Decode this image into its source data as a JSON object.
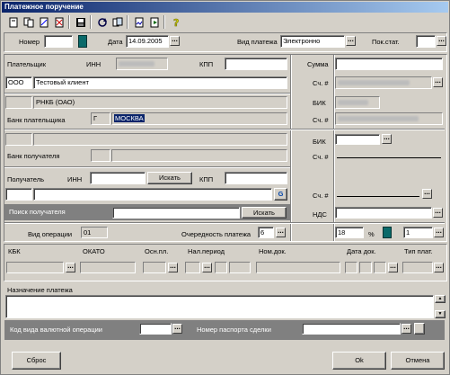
{
  "window": {
    "title": "Платежное поручение"
  },
  "toolbar": {
    "icons": [
      "new-document-icon",
      "copy-document-icon",
      "edit-document-icon",
      "delete-document-icon",
      "save-icon",
      "refresh-icon",
      "copy-icon",
      "sign-icon",
      "export-icon",
      "help-icon"
    ]
  },
  "doc": {
    "number_label": "Номер",
    "number_value": "",
    "date_label": "Дата",
    "date_value": "14.09.2005",
    "payment_type_label": "Вид платежа",
    "payment_type_value": "Электронно",
    "status_label": "Пок.стат.",
    "status_value": ""
  },
  "payer": {
    "label": "Плательщик",
    "inn_label": "ИНН",
    "kpp_label": "КПП",
    "name_prefix": "ООО",
    "name": "Тестовый клиент",
    "sum_label": "Сумма",
    "account_label": "Сч. #"
  },
  "payer_bank": {
    "name": "РНКБ (ОАО)",
    "label": "Банк плательщика",
    "city_prefix": "Г",
    "city": "МОСКВА",
    "bik_label": "БИК",
    "account_label": "Сч. #"
  },
  "payee_bank": {
    "label": "Банк получателя",
    "bik_label": "БИК",
    "account_label": "Сч. #"
  },
  "payee": {
    "label": "Получатель",
    "inn_label": "ИНН",
    "search_button": "Искать",
    "kpp_label": "КПП",
    "account_label": "Сч. #",
    "search_label": "Поиск получателя",
    "search_button2": "Искать",
    "vat_label": "НДС"
  },
  "operation": {
    "type_label": "Вид операции",
    "type_value": "01",
    "priority_label": "Очередность платежа",
    "priority_value": "6",
    "vat_rate": "18",
    "percent": "%",
    "vat_mode": "1"
  },
  "budget": {
    "kbk": "КБК",
    "okato": "ОКАТО",
    "basis": "Осн.пл.",
    "tax_period": "Нал.период",
    "doc_number": "Ном.док.",
    "doc_date": "Дата док.",
    "payment_type": "Тип плат."
  },
  "purpose": {
    "label": "Назначение платежа",
    "value": ""
  },
  "currency": {
    "op_label": "Код вида валютной операции",
    "passport_label": "Номер паспорта сделки"
  },
  "footer": {
    "reset": "Сброс",
    "ok": "Ok",
    "cancel": "Отмена"
  }
}
